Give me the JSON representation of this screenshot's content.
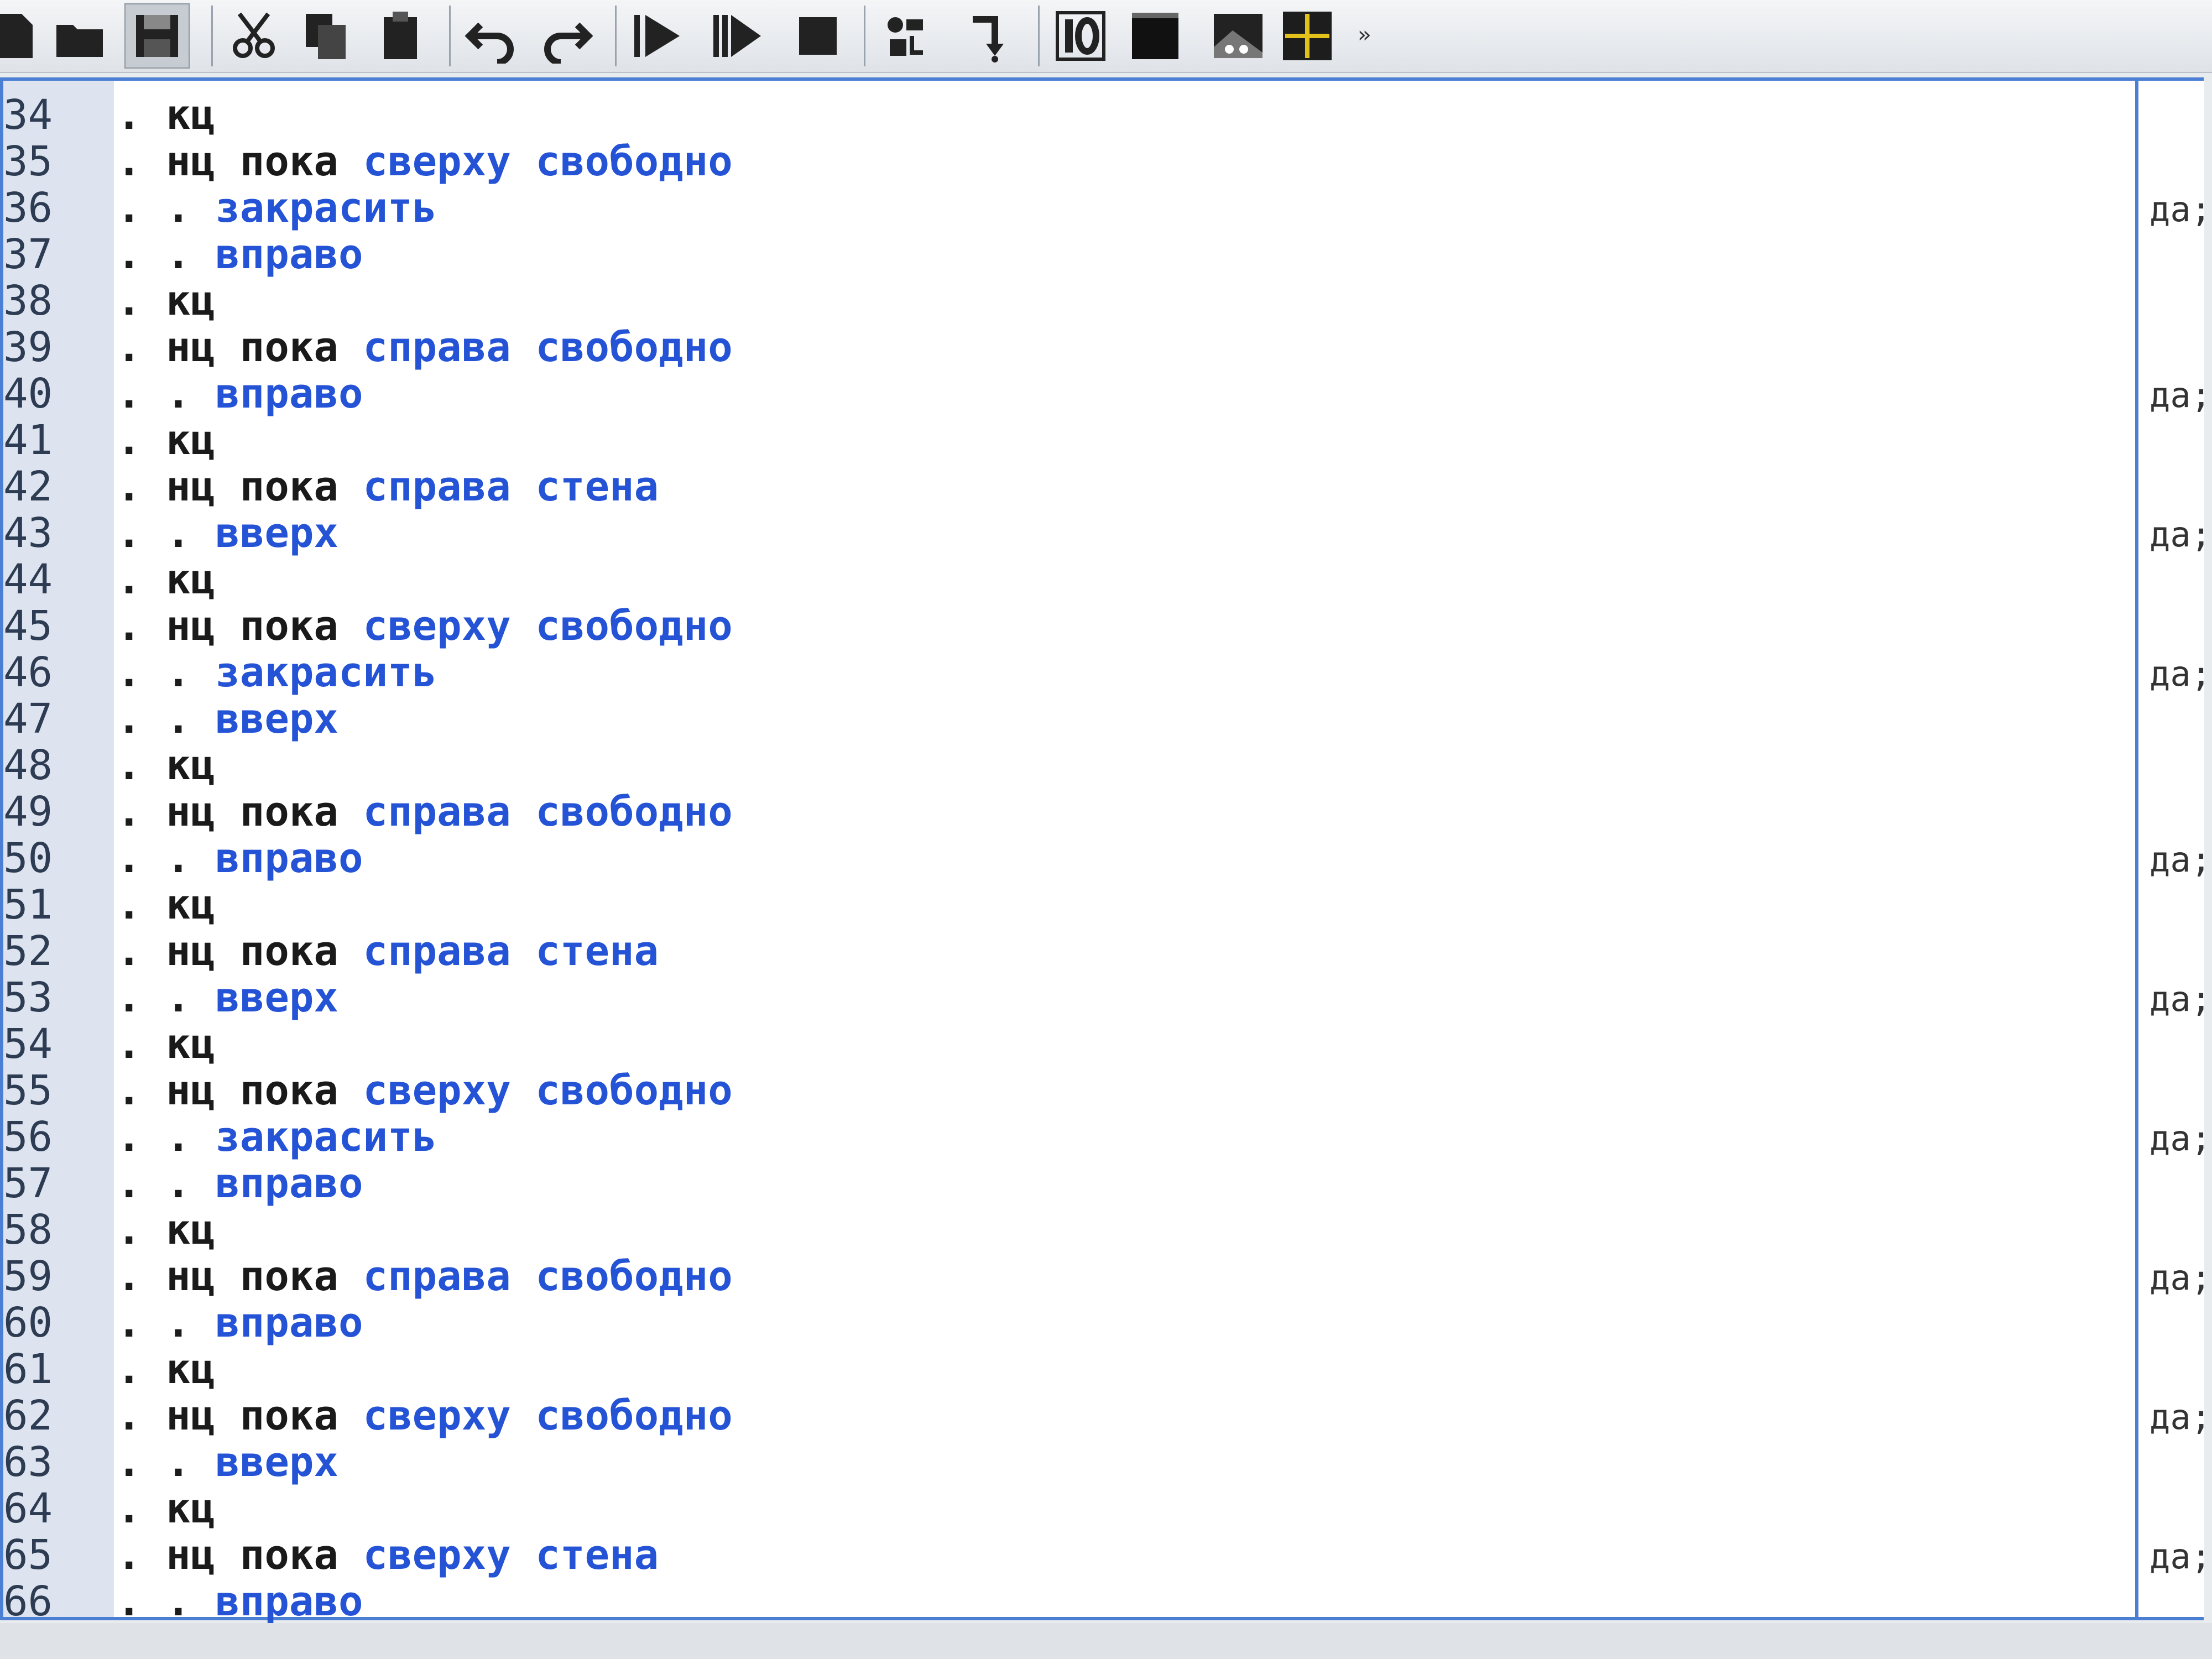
{
  "toolbar": {
    "buttons": [
      {
        "name": "new-file-icon"
      },
      {
        "name": "open-folder-icon"
      },
      {
        "name": "save-icon"
      },
      {
        "name": "cut-icon"
      },
      {
        "name": "copy-icon"
      },
      {
        "name": "paste-icon"
      },
      {
        "name": "undo-icon"
      },
      {
        "name": "redo-icon"
      },
      {
        "name": "run-icon"
      },
      {
        "name": "step-run-icon"
      },
      {
        "name": "stop-icon"
      },
      {
        "name": "step-over-icon"
      },
      {
        "name": "step-into-icon"
      },
      {
        "name": "io-window-icon"
      },
      {
        "name": "terminal-window-icon"
      },
      {
        "name": "robot-field-icon"
      },
      {
        "name": "drawer-icon"
      }
    ],
    "more_label": "»"
  },
  "editor": {
    "lines": [
      {
        "n": "34",
        "indent": ". ",
        "kw": "кц",
        "fn": ""
      },
      {
        "n": "35",
        "indent": ". ",
        "kw": "нц пока",
        "fn": "сверху свободно"
      },
      {
        "n": "36",
        "indent": ". . ",
        "kw": "",
        "fn": "закрасить"
      },
      {
        "n": "37",
        "indent": ". . ",
        "kw": "",
        "fn": "вправо"
      },
      {
        "n": "38",
        "indent": ". ",
        "kw": "кц",
        "fn": ""
      },
      {
        "n": "39",
        "indent": ". ",
        "kw": "нц пока",
        "fn": "справа свободно"
      },
      {
        "n": "40",
        "indent": ". . ",
        "kw": "",
        "fn": "вправо"
      },
      {
        "n": "41",
        "indent": ". ",
        "kw": "кц",
        "fn": ""
      },
      {
        "n": "42",
        "indent": ". ",
        "kw": "нц пока",
        "fn": "справа стена"
      },
      {
        "n": "43",
        "indent": ". . ",
        "kw": "",
        "fn": "вверх"
      },
      {
        "n": "44",
        "indent": ". ",
        "kw": "кц",
        "fn": ""
      },
      {
        "n": "45",
        "indent": ". ",
        "kw": "нц пока",
        "fn": "сверху свободно"
      },
      {
        "n": "46",
        "indent": ". . ",
        "kw": "",
        "fn": "закрасить"
      },
      {
        "n": "47",
        "indent": ". . ",
        "kw": "",
        "fn": "вверх"
      },
      {
        "n": "48",
        "indent": ". ",
        "kw": "кц",
        "fn": ""
      },
      {
        "n": "49",
        "indent": ". ",
        "kw": "нц пока",
        "fn": "справа свободно"
      },
      {
        "n": "50",
        "indent": ". . ",
        "kw": "",
        "fn": "вправо"
      },
      {
        "n": "51",
        "indent": ". ",
        "kw": "кц",
        "fn": ""
      },
      {
        "n": "52",
        "indent": ". ",
        "kw": "нц пока",
        "fn": "справа стена"
      },
      {
        "n": "53",
        "indent": ". . ",
        "kw": "",
        "fn": "вверх"
      },
      {
        "n": "54",
        "indent": ". ",
        "kw": "кц",
        "fn": ""
      },
      {
        "n": "55",
        "indent": ". ",
        "kw": "нц пока",
        "fn": "сверху свободно"
      },
      {
        "n": "56",
        "indent": ". . ",
        "kw": "",
        "fn": "закрасить"
      },
      {
        "n": "57",
        "indent": ". . ",
        "kw": "",
        "fn": "вправо"
      },
      {
        "n": "58",
        "indent": ". ",
        "kw": "кц",
        "fn": ""
      },
      {
        "n": "59",
        "indent": ". ",
        "kw": "нц пока",
        "fn": "справа свободно"
      },
      {
        "n": "60",
        "indent": ". . ",
        "kw": "",
        "fn": "вправо"
      },
      {
        "n": "61",
        "indent": ". ",
        "kw": "кц",
        "fn": ""
      },
      {
        "n": "62",
        "indent": ". ",
        "kw": "нц пока",
        "fn": "сверху свободно"
      },
      {
        "n": "63",
        "indent": ". . ",
        "kw": "",
        "fn": "вверх"
      },
      {
        "n": "64",
        "indent": ". ",
        "kw": "кц",
        "fn": ""
      },
      {
        "n": "65",
        "indent": ". ",
        "kw": "нц пока",
        "fn": "сверху стена"
      },
      {
        "n": "66",
        "indent": ". . ",
        "kw": "",
        "fn": "вправо"
      }
    ]
  },
  "margin": {
    "notes": [
      {
        "line": "36",
        "text": "да;"
      },
      {
        "line": "40",
        "text": "да;"
      },
      {
        "line": "43",
        "text": "да;"
      },
      {
        "line": "46",
        "text": "да;"
      },
      {
        "line": "50",
        "text": "да;"
      },
      {
        "line": "53",
        "text": "да;"
      },
      {
        "line": "56",
        "text": "да;"
      },
      {
        "line": "59",
        "text": "да;"
      },
      {
        "line": "62",
        "text": "да;"
      },
      {
        "line": "65",
        "text": "да;"
      }
    ]
  },
  "colors": {
    "keyword": "#1a1a1a",
    "command": "#2553d6",
    "border": "#4a7fd4",
    "gutter": "#dde4ef"
  }
}
